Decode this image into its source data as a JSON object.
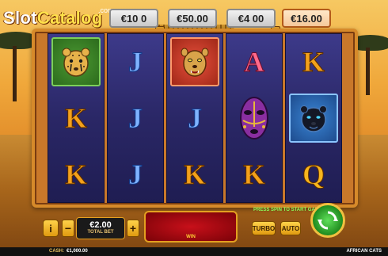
{
  "logo": {
    "brand": "Slot",
    "brand2": "Catalog",
    "suffix": ".com"
  },
  "jackpots": [
    {
      "value": "€10 0"
    },
    {
      "value": "€50.00"
    },
    {
      "value": "€4 00"
    },
    {
      "value": "€16.00"
    }
  ],
  "reels": [
    [
      "cheetah",
      "K",
      "K"
    ],
    [
      "J",
      "J",
      "J"
    ],
    [
      "lioness",
      "J",
      "K"
    ],
    [
      "A",
      "mask",
      "K"
    ],
    [
      "K",
      "panther",
      "Q"
    ]
  ],
  "icons": {
    "cheetah": "cheetah-icon",
    "lioness": "lioness-icon",
    "mask": "tribal-mask-icon",
    "panther": "panther-icon",
    "spin": "spin-arrows-icon",
    "lock": "padlock-icon"
  },
  "controls": {
    "info_label": "i",
    "minus_label": "−",
    "plus_label": "+",
    "bet_value": "€2.00",
    "bet_label": "TOTAL BET",
    "win_label": "WIN",
    "press_spin": "PRESS SPIN TO START GAME",
    "turbo_label": "TURBO",
    "auto_label": "AUTO"
  },
  "status": {
    "cash_label": "CASH:",
    "cash_value": "€1,000.00",
    "game_name": "AFRICAN CATS"
  },
  "colors": {
    "frame": "#d68a2a",
    "reel_bg": "#2a2766",
    "spin_button": "#1f8a1e",
    "win_box": "#c8101a"
  }
}
